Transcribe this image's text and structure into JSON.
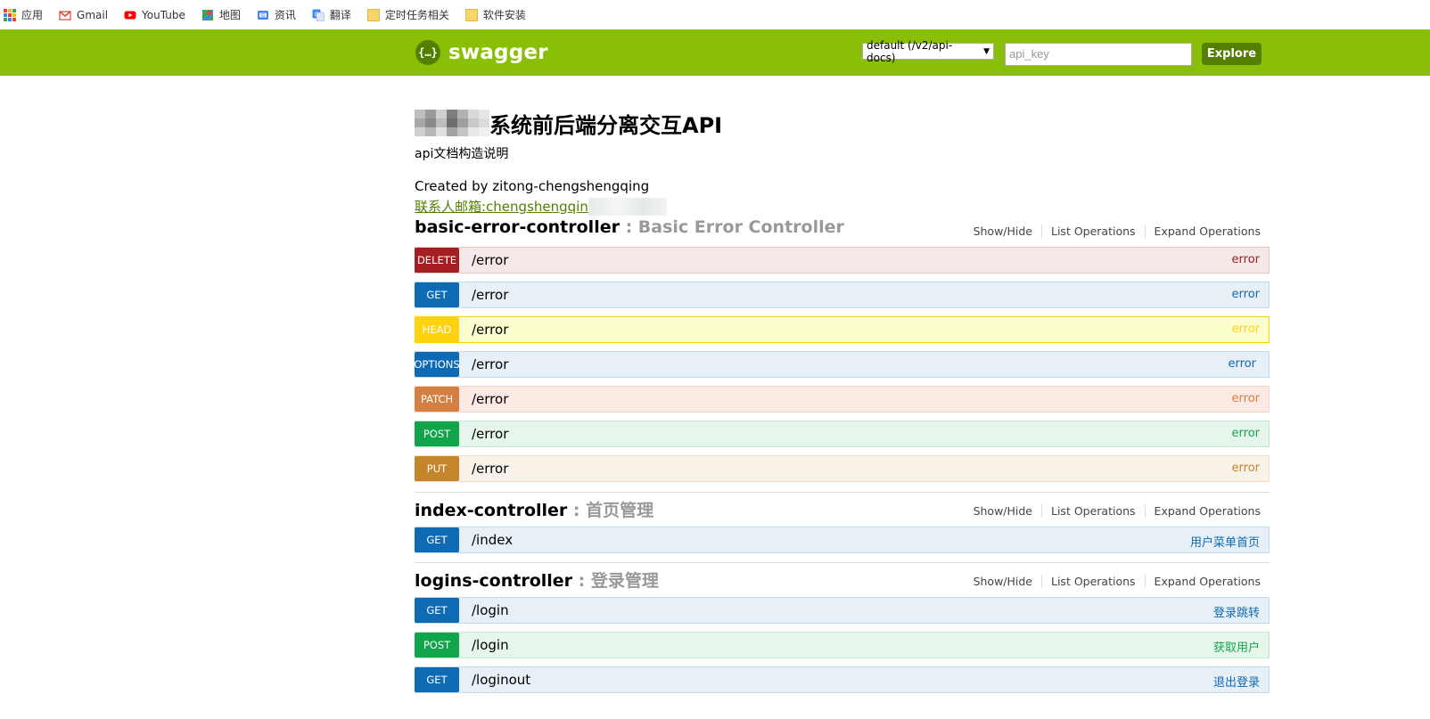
{
  "bookmarks": [
    {
      "label": "应用",
      "icon": "apps-icon"
    },
    {
      "label": "Gmail",
      "icon": "gmail-icon"
    },
    {
      "label": "YouTube",
      "icon": "youtube-icon"
    },
    {
      "label": "地图",
      "icon": "maps-icon"
    },
    {
      "label": "资讯",
      "icon": "news-icon"
    },
    {
      "label": "翻译",
      "icon": "translate-icon"
    },
    {
      "label": "定时任务相关",
      "icon": "folder-icon"
    },
    {
      "label": "软件安装",
      "icon": "folder-icon"
    }
  ],
  "header": {
    "logo_text": "swagger",
    "logo_badge": "{…}",
    "spec_select": "default (/v2/api-docs)",
    "api_key_placeholder": "api_key",
    "explore_label": "Explore",
    "bar_color": "#89bf04"
  },
  "info": {
    "title": "系统前后端分离交互API",
    "description": "api文档构造说明",
    "created_by": "Created by zitong-chengshengqing",
    "contact": "联系人邮箱:chengshengqin"
  },
  "resource_ops": [
    "Show/Hide",
    "List Operations",
    "Expand Operations"
  ],
  "resources": [
    {
      "name": "basic-error-controller",
      "description": " : Basic Error Controller",
      "endpoints": [
        {
          "method": "DELETE",
          "path": "/error",
          "summary": "error"
        },
        {
          "method": "GET",
          "path": "/error",
          "summary": "error"
        },
        {
          "method": "HEAD",
          "path": "/error",
          "summary": "error"
        },
        {
          "method": "OPTIONS",
          "path": "/error",
          "summary": "error"
        },
        {
          "method": "PATCH",
          "path": "/error",
          "summary": "error"
        },
        {
          "method": "POST",
          "path": "/error",
          "summary": "error"
        },
        {
          "method": "PUT",
          "path": "/error",
          "summary": "error"
        }
      ]
    },
    {
      "name": "index-controller",
      "description": " : 首页管理",
      "endpoints": [
        {
          "method": "GET",
          "path": "/index",
          "summary": "用户菜单首页"
        }
      ]
    },
    {
      "name": "logins-controller",
      "description": " : 登录管理",
      "endpoints": [
        {
          "method": "GET",
          "path": "/login",
          "summary": "登录跳转"
        },
        {
          "method": "POST",
          "path": "/login",
          "summary": "获取用户"
        },
        {
          "method": "GET",
          "path": "/loginout",
          "summary": "退出登录"
        }
      ]
    }
  ]
}
